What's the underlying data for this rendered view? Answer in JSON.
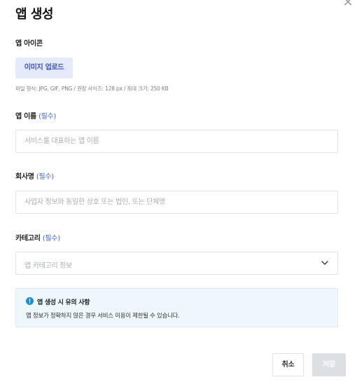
{
  "dialog": {
    "title": "앱 생성",
    "close_symbol": "✕"
  },
  "app_icon": {
    "label": "앱 아이콘",
    "upload_button": "이미지 업로드",
    "hint": "파일 형식: JPG, GIF, PNG / 권장 사이즈: 128 px / 최대 크기: 250 KB"
  },
  "app_name": {
    "label": "앱 이름",
    "required_tag": "(필수)",
    "placeholder": "서비스를 대표하는 앱 이름",
    "value": ""
  },
  "company": {
    "label": "회사명",
    "required_tag": "(필수)",
    "placeholder": "사업자 정보와 동일한 상호 또는 법인, 또는 단체명",
    "value": ""
  },
  "category": {
    "label": "카테고리",
    "required_tag": "(필수)",
    "placeholder": "앱 카테고리 정보"
  },
  "notice": {
    "title": "앱 생성 시 유의 사항",
    "body": "앱 정보가 정확하지 않은 경우 서비스 이용이 제한될 수 있습니다."
  },
  "actions": {
    "cancel_label": "취소",
    "save_label": "저장"
  },
  "colors": {
    "accent": "#3b62e6",
    "upload_bg": "#e6ebfb",
    "notice_bg": "#eef7fc",
    "info_icon": "#1a8fe0",
    "save_disabled_bg": "#dcdfe3"
  },
  "icons": {
    "close": "close-icon",
    "chevron": "chevron-down-icon",
    "info": "info-icon"
  }
}
